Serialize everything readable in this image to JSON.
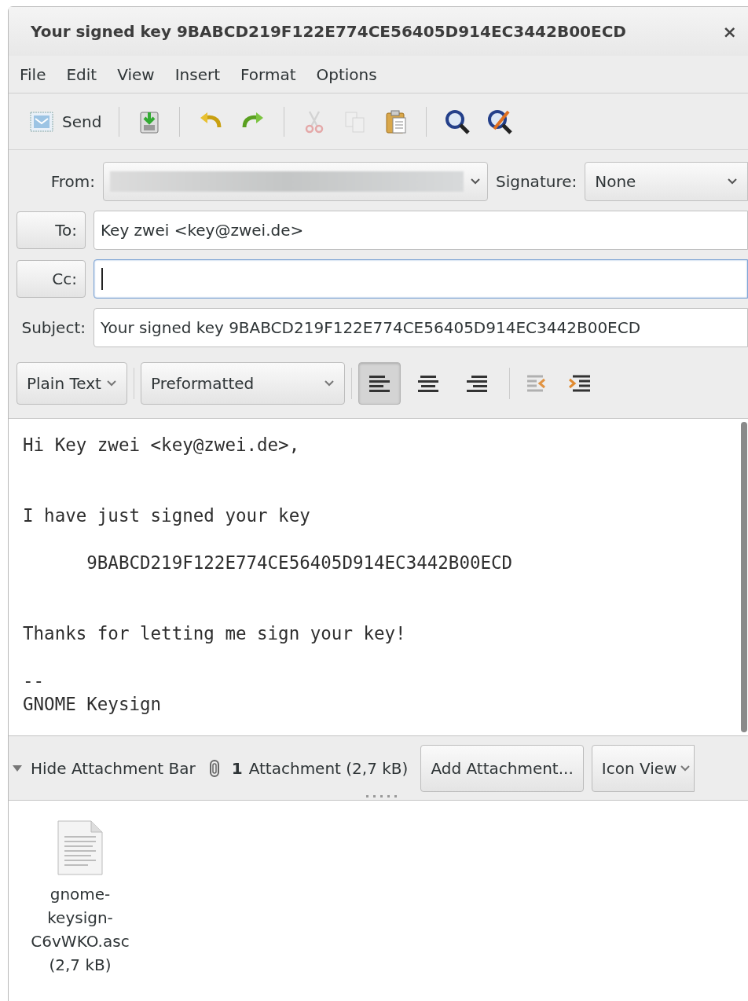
{
  "window": {
    "title": "Your signed key 9BABCD219F122E774CE56405D914EC3442B00ECD",
    "close": "×"
  },
  "menu": [
    "File",
    "Edit",
    "View",
    "Insert",
    "Format",
    "Options"
  ],
  "toolbar": [
    {
      "kind": "send",
      "label": "Send",
      "disabled": false
    },
    {
      "kind": "separator"
    },
    {
      "kind": "save",
      "disabled": false
    },
    {
      "kind": "separator"
    },
    {
      "kind": "undo",
      "disabled": false
    },
    {
      "kind": "redo",
      "disabled": false
    },
    {
      "kind": "separator"
    },
    {
      "kind": "cut",
      "disabled": true
    },
    {
      "kind": "copy",
      "disabled": true
    },
    {
      "kind": "paste",
      "disabled": false
    },
    {
      "kind": "separator"
    },
    {
      "kind": "find",
      "disabled": false
    },
    {
      "kind": "replace",
      "disabled": false
    }
  ],
  "header": {
    "from_label": "From:",
    "signature_label": "Signature:",
    "signature_value": "None",
    "fields": [
      {
        "kind": "button",
        "label": "To:",
        "value": "Key zwei <key@zwei.de>",
        "focused": false
      },
      {
        "kind": "button",
        "label": "Cc:",
        "focused": true
      },
      {
        "kind": "plain",
        "label": "Subject:",
        "value": "Your signed key 9BABCD219F122E774CE56405D914EC3442B00ECD",
        "focused": false
      }
    ]
  },
  "format_bar": {
    "mode": "Plain Text",
    "paragraph_style": "Preformatted",
    "align": [
      {
        "kind": "left",
        "selected": true
      },
      {
        "kind": "center",
        "selected": false
      },
      {
        "kind": "right",
        "selected": false
      }
    ],
    "indent": [
      {
        "kind": "unindent"
      },
      {
        "kind": "indent"
      }
    ]
  },
  "body": {
    "text": "Hi Key zwei <key@zwei.de>,\n\n\nI have just signed your key\n\n      9BABCD219F122E774CE56405D914EC3442B00ECD\n\n\nThanks for letting me sign your key!\n\n--\nGNOME Keysign"
  },
  "attachment_bar": {
    "toggle": "Hide Attachment Bar",
    "expanded": true,
    "count": "1",
    "summary": "Attachment (2,7 kB)",
    "add_button": "Add Attachment...",
    "view_mode": "Icon View"
  },
  "attachments": [
    {
      "name": "gnome-keysign-C6vWKO.asc",
      "size": "(2,7 kB)"
    }
  ]
}
